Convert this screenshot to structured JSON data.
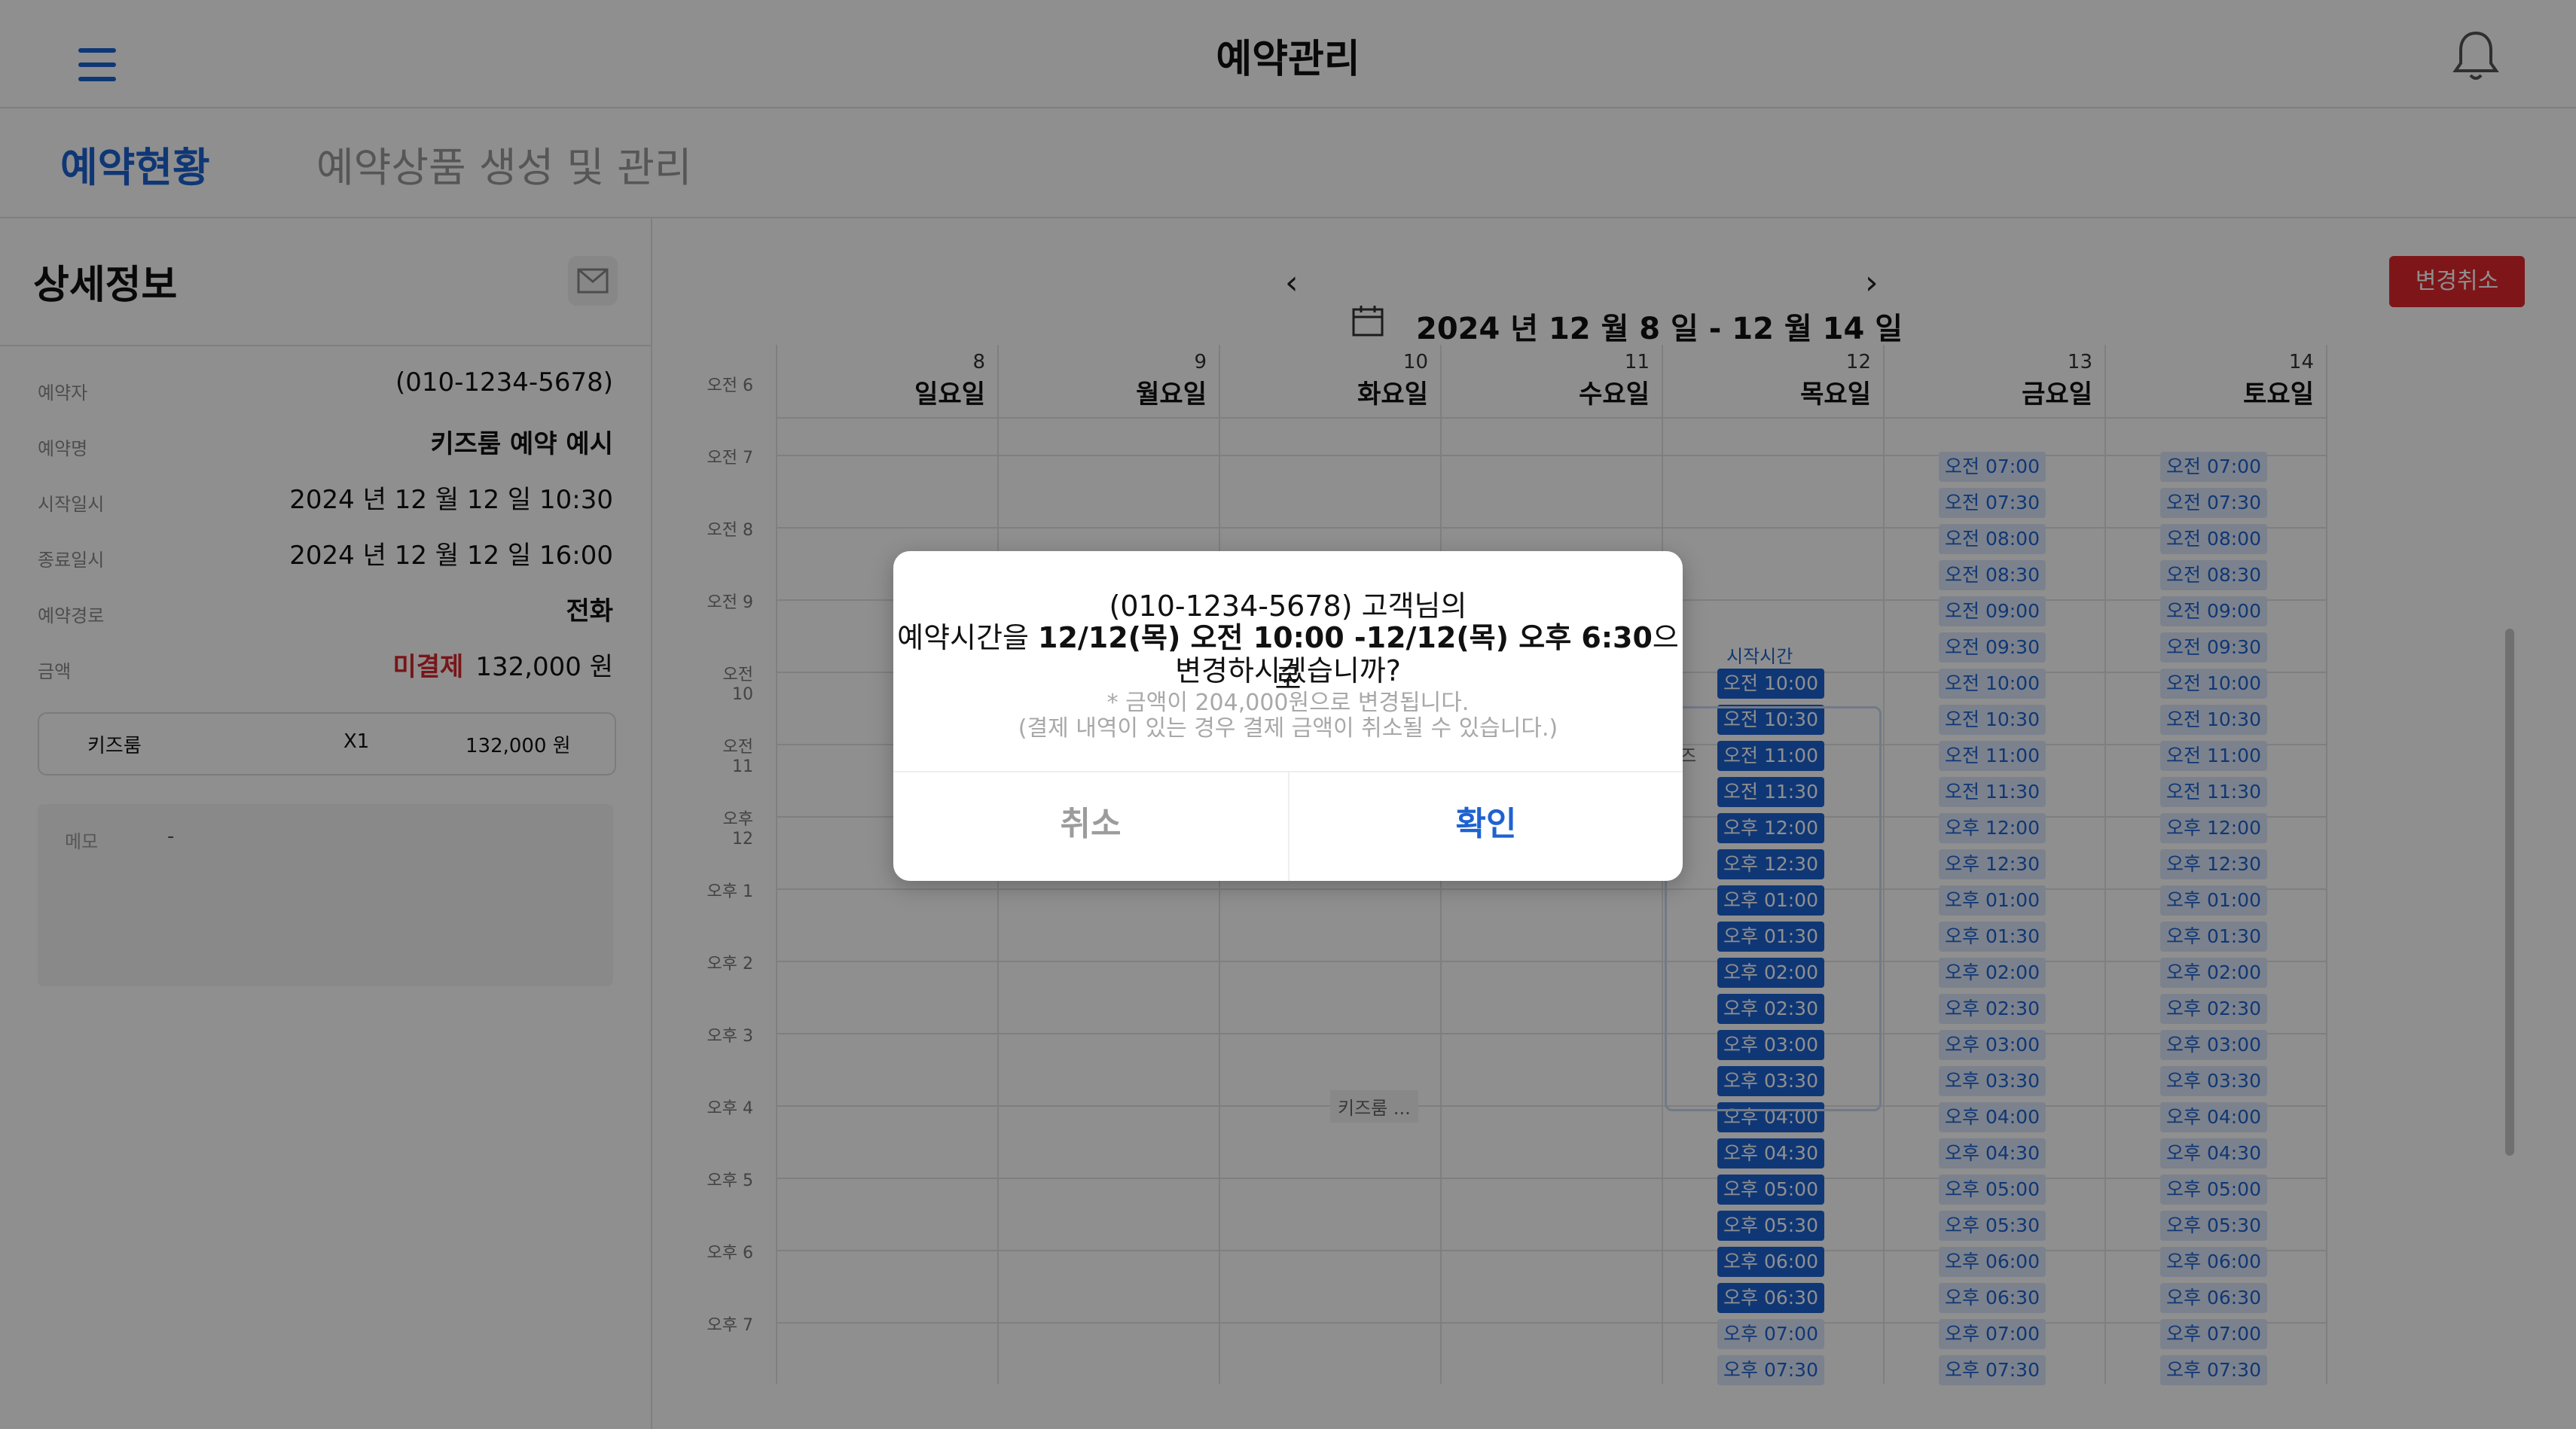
{
  "header": {
    "title": "예약관리"
  },
  "tabs": [
    {
      "label": "예약현황",
      "active": true
    },
    {
      "label": "예약상품 생성 및 관리",
      "active": false
    }
  ],
  "detail": {
    "title": "상세정보",
    "rows": [
      {
        "label": "예약자",
        "value": "(010-1234-5678)"
      },
      {
        "label": "예약명",
        "value": "키즈룸 예약 예시"
      },
      {
        "label": "시작일시",
        "value": "2024 년 12 월 12 일 10:30"
      },
      {
        "label": "종료일시",
        "value": "2024 년 12 월 12 일 16:00"
      },
      {
        "label": "예약경로",
        "value": "전화"
      }
    ],
    "amount": {
      "label": "금액",
      "status": "미결제",
      "value": "132,000 원"
    },
    "item": {
      "name": "키즈룸",
      "qty": "X1",
      "price": "132,000 원"
    },
    "memo": {
      "label": "메모",
      "value": "-"
    }
  },
  "calendar": {
    "week_label": "2024 년 12 월 8 일 - 12 월 14 일",
    "cancel_change_label": "변경취소",
    "days": [
      {
        "num": "8",
        "name": "일요일"
      },
      {
        "num": "9",
        "name": "월요일"
      },
      {
        "num": "10",
        "name": "화요일"
      },
      {
        "num": "11",
        "name": "수요일"
      },
      {
        "num": "12",
        "name": "목요일"
      },
      {
        "num": "13",
        "name": "금요일"
      },
      {
        "num": "14",
        "name": "토요일"
      }
    ],
    "hours": [
      "오전 6",
      "오전 7",
      "오전 8",
      "오전 9",
      "오전 10",
      "오전 11",
      "오후 12",
      "오후 1",
      "오후 2",
      "오후 3",
      "오후 4",
      "오후 5",
      "오후 6",
      "오후 7"
    ],
    "start_label": "시작시간",
    "booking_chip": "키즈룸 ...",
    "ghost_chip": "키즈",
    "thu_selected_slots": [
      "오전 10:00",
      "오전 10:30",
      "오전 11:00",
      "오전 11:30",
      "오후 12:00",
      "오후 12:30",
      "오후 01:00",
      "오후 01:30",
      "오후 02:00",
      "오후 02:30",
      "오후 03:00",
      "오후 03:30",
      "오후 04:00",
      "오후 04:30",
      "오후 05:00",
      "오후 05:30",
      "오후 06:00",
      "오후 06:30"
    ],
    "thu_after_slots": [
      "오후 07:00",
      "오후 07:30"
    ],
    "side_slots": [
      "오전 07:00",
      "오전 07:30",
      "오전 08:00",
      "오전 08:30",
      "오전 09:00",
      "오전 09:30",
      "오전 10:00",
      "오전 10:30",
      "오전 11:00",
      "오전 11:30",
      "오후 12:00",
      "오후 12:30",
      "오후 01:00",
      "오후 01:30",
      "오후 02:00",
      "오후 02:30",
      "오후 03:00",
      "오후 03:30",
      "오후 04:00",
      "오후 04:30",
      "오후 05:00",
      "오후 05:30",
      "오후 06:00",
      "오후 06:30",
      "오후 07:00",
      "오후 07:30"
    ]
  },
  "dialog": {
    "line1": "(010-1234-5678) 고객님의",
    "line2_prefix": "예약시간을 ",
    "line2_bold": "12/12(목) 오전 10:00 -12/12(목) 오후 6:30",
    "line2_suffix": "으로",
    "line3": "변경하시겠습니까?",
    "note1": "* 금액이 204,000원으로 변경됩니다.",
    "note2": "(결제 내역이 있는 경우 결제 금액이 취소될 수 있습니다.)",
    "cancel_label": "취소",
    "confirm_label": "확인"
  },
  "colors": {
    "accent": "#1e62d0",
    "danger": "#e0282e",
    "overlay": "rgba(0,0,0,0.44)"
  }
}
